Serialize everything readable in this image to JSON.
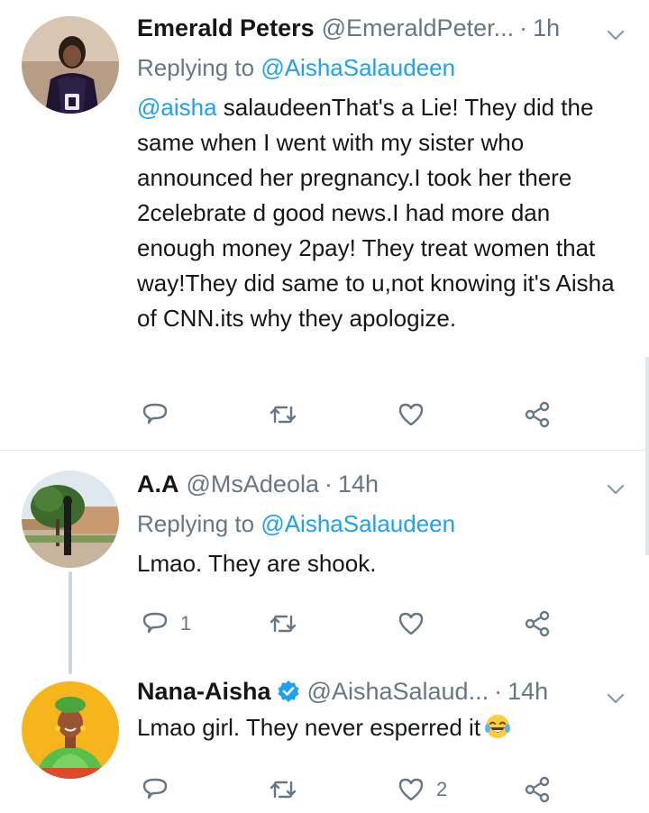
{
  "colors": {
    "accent": "#1da1f2",
    "muted": "#657786",
    "text": "#14171a",
    "divider": "#e1e8ed",
    "thread": "#ccd6dd"
  },
  "tweets": [
    {
      "name": "Emerald Peters",
      "handle": "@EmeraldPeter...",
      "separator": "·",
      "time": "1h",
      "replying_prefix": "Replying to",
      "replying_to": "@AishaSalaudeen",
      "mention": "@aisha",
      "body": " salaudeenThat's a Lie! They did the same when I went with my sister who announced her pregnancy.I took her there 2celebrate d good news.I had more dan enough money 2pay! They treat women that way!They did same to u,not knowing it's Aisha of CNN.its why they apologize.",
      "reply_count": "",
      "retweet_count": "",
      "like_count": "",
      "avatar_icon": "avatar-photo"
    },
    {
      "name": "A.A",
      "handle": "@MsAdeola",
      "separator": "·",
      "time": "14h",
      "replying_prefix": "Replying to",
      "replying_to": "@AishaSalaudeen",
      "body": "Lmao. They are shook.",
      "reply_count": "1",
      "retweet_count": "",
      "like_count": "",
      "avatar_icon": "avatar-photo"
    },
    {
      "name": "Nana-Aisha",
      "handle": "@AishaSalaud...",
      "separator": "·",
      "time": "14h",
      "verified": true,
      "body": "Lmao girl. They never esperred it",
      "emoji": "face-with-tears-of-joy",
      "reply_count": "",
      "retweet_count": "",
      "like_count": "2",
      "avatar_icon": "avatar-illustration"
    }
  ]
}
